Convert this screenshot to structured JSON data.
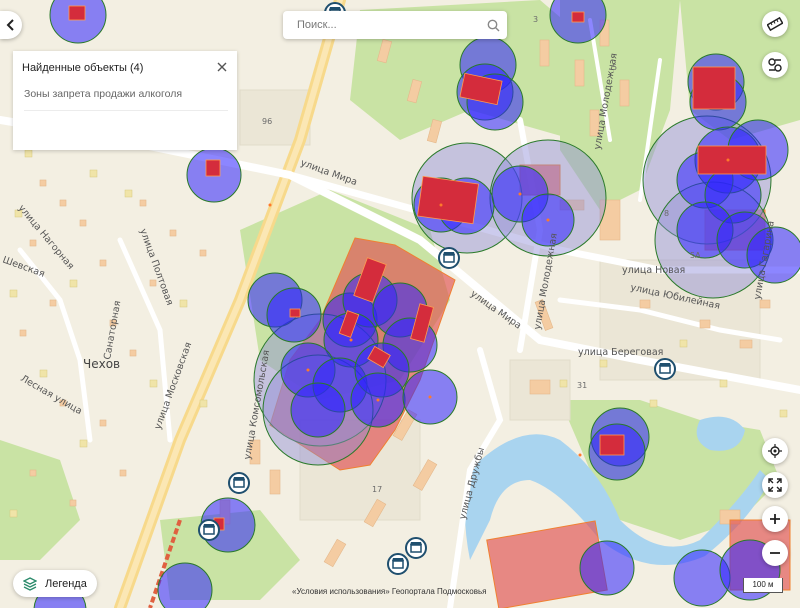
{
  "search": {
    "placeholder": "Поиск..."
  },
  "results_panel": {
    "title": "Найденные объекты (4)",
    "items": [
      "Зоны запрета продажи алкоголя"
    ]
  },
  "legend": {
    "label": "Легенда"
  },
  "attribution": "«Условия использования» Геопортала Подмосковья",
  "scale_label": "100 м",
  "map": {
    "town_label": "Чехов",
    "streets": [
      "улица Нагорная",
      "улица Полтовая",
      "Лесная улица",
      "Шевская",
      "Санаторная",
      "улица Московская",
      "улица Мира",
      "улица Мира",
      "улица Молодежная",
      "улица Молодежная",
      "улица Новая",
      "улица Юбилейная",
      "улица Береговая",
      "улица Дружбы",
      "улица Комсомольская",
      "улица Гагарина"
    ],
    "building_numbers": [
      "96",
      "3",
      "5",
      "8",
      "31",
      "17",
      "5А"
    ],
    "colors": {
      "zone_fill": "#2d22ff",
      "zone_fill_light": "#6f6ae0",
      "zone_red": "#e05050",
      "zone_outline": "#2a7a2a",
      "green_area": "#c9e3a4",
      "road": "#f7d98b",
      "building": "#f2c9a0"
    }
  }
}
